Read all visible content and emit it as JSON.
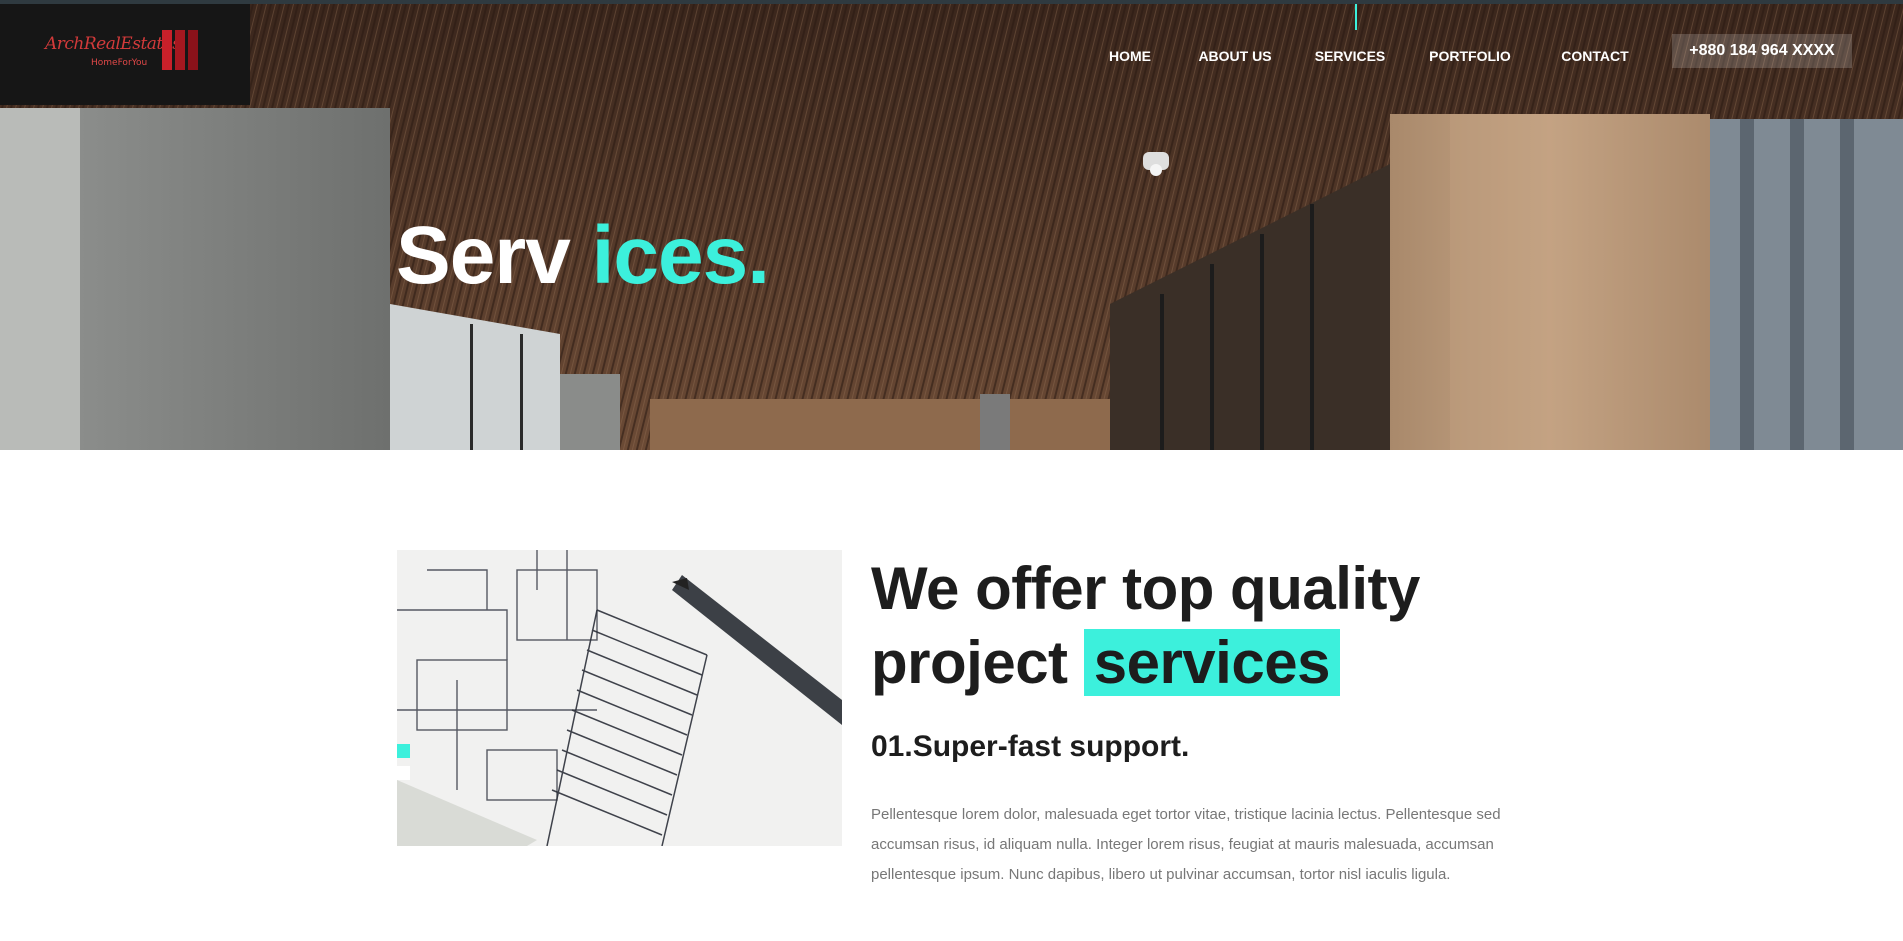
{
  "brand": {
    "logo_text": "ArchRealEstates",
    "logo_sub": "HomeForYou"
  },
  "nav": {
    "items": [
      "HOME",
      "ABOUT US",
      "SERVICES",
      "PORTFOLIO",
      "CONTACT"
    ],
    "active": "SERVICES",
    "phone": "+880 184 964 XXXX"
  },
  "hero": {
    "title_white": "Serv",
    "title_accent": "ices."
  },
  "section": {
    "headline_line1": "We offer top quality",
    "headline_line2_plain": "project ",
    "headline_highlight": "services",
    "subheading": "01.Super-fast support.",
    "paragraph": "Pellentesque lorem dolor, malesuada eget tortor vitae, tristique lacinia lectus. Pellentesque sed accumsan risus, id aliquam nulla. Integer lorem risus, feugiat at mauris malesuada, accumsan pellentesque ipsum. Nunc dapibus, libero ut pulvinar accumsan, tortor nisl iaculis ligula."
  },
  "colors": {
    "accent": "#3cf0dc",
    "logo_red": "#c8202a",
    "text_dark": "#1d1d1d",
    "text_muted": "#777777"
  },
  "icons": [
    "logo-bars-icon"
  ]
}
